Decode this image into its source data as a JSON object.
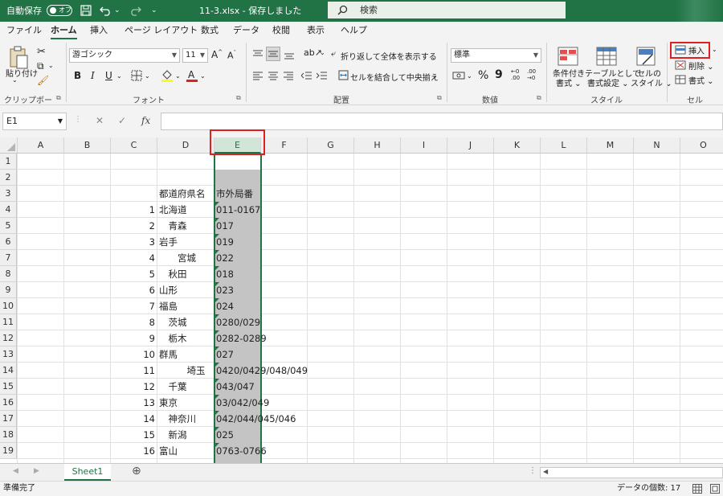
{
  "titlebar": {
    "autosave_label": "自動保存",
    "autosave_toggle": "オフ",
    "filename": "11-3.xlsx - 保存しました",
    "filename_arrow": "⌄",
    "search_placeholder": "検索"
  },
  "menu_tabs": [
    "ファイル",
    "ホーム",
    "挿入",
    "ページ レイアウト",
    "数式",
    "データ",
    "校閲",
    "表示",
    "ヘルプ"
  ],
  "ribbon": {
    "clipboard": {
      "paste_label": "貼り付け",
      "group_label": "クリップボード"
    },
    "font": {
      "font_name": "游ゴシック",
      "font_size": "11",
      "group_label": "フォント",
      "bold": "B",
      "italic": "I",
      "underline": "U",
      "grow": "A",
      "shrink": "A"
    },
    "alignment": {
      "wrap_text": "折り返して全体を表示する",
      "merge_center": "セルを結合して中央揃え",
      "group_label": "配置"
    },
    "number": {
      "format": "標準",
      "group_label": "数値",
      "percent": "%",
      "comma": "9"
    },
    "styles": {
      "conditional_1": "条件付き",
      "conditional_2": "書式 ⌄",
      "table_1": "テーブルとして",
      "table_2": "書式設定 ⌄",
      "cell_1": "セルの",
      "cell_2": "スタイル ⌄",
      "group_label": "スタイル"
    },
    "cells": {
      "insert": "挿入",
      "delete": "削除 ⌄",
      "format": "書式 ⌄",
      "group_label": "セル"
    }
  },
  "formula_bar": {
    "name_box": "E1",
    "cancel": "✕",
    "enter": "✓",
    "fx": "fx",
    "formula": ""
  },
  "columns": [
    "A",
    "B",
    "C",
    "D",
    "E",
    "F",
    "G",
    "H",
    "I",
    "J",
    "K",
    "L",
    "M",
    "N",
    "O"
  ],
  "rows": [
    "1",
    "2",
    "3",
    "4",
    "5",
    "6",
    "7",
    "8",
    "9",
    "10",
    "11",
    "12",
    "13",
    "14",
    "15",
    "16",
    "17",
    "18",
    "19"
  ],
  "sheet": {
    "header_d": "都道府県名",
    "header_e": "市外局番",
    "records": [
      {
        "row": 4,
        "no": "1",
        "pref": "北海道",
        "code": "011-0167"
      },
      {
        "row": 5,
        "no": "2",
        "pref": "　青森",
        "code": "017"
      },
      {
        "row": 6,
        "no": "3",
        "pref": "岩手",
        "code": "019"
      },
      {
        "row": 7,
        "no": "4",
        "pref": "　　宮城",
        "code": "022"
      },
      {
        "row": 8,
        "no": "5",
        "pref": "　秋田",
        "code": "018"
      },
      {
        "row": 9,
        "no": "6",
        "pref": "山形",
        "code": "023"
      },
      {
        "row": 10,
        "no": "7",
        "pref": "福島",
        "code": "024"
      },
      {
        "row": 11,
        "no": "8",
        "pref": "　茨城",
        "code": "0280/029"
      },
      {
        "row": 12,
        "no": "9",
        "pref": "　栃木",
        "code": "0282-0289"
      },
      {
        "row": 13,
        "no": "10",
        "pref": "群馬",
        "code": "027"
      },
      {
        "row": 14,
        "no": "11",
        "pref": "　　　埼玉",
        "code": "0420/0429/048/049"
      },
      {
        "row": 15,
        "no": "12",
        "pref": "　千葉",
        "code": "043/047"
      },
      {
        "row": 16,
        "no": "13",
        "pref": "東京",
        "code": "03/042/049"
      },
      {
        "row": 17,
        "no": "14",
        "pref": "　神奈川",
        "code": "042/044/045/046"
      },
      {
        "row": 18,
        "no": "15",
        "pref": "　新潟",
        "code": "025"
      },
      {
        "row": 19,
        "no": "16",
        "pref": "富山",
        "code": "0763-0766"
      }
    ]
  },
  "sheet_tabs": {
    "active": "Sheet1",
    "add": "⊕"
  },
  "status": {
    "ready": "準備完了",
    "count": "データの個数: 17"
  },
  "colors": {
    "excel_green": "#217346",
    "highlight_red": "#e02020",
    "selection_gray": "#c4c4c4"
  }
}
